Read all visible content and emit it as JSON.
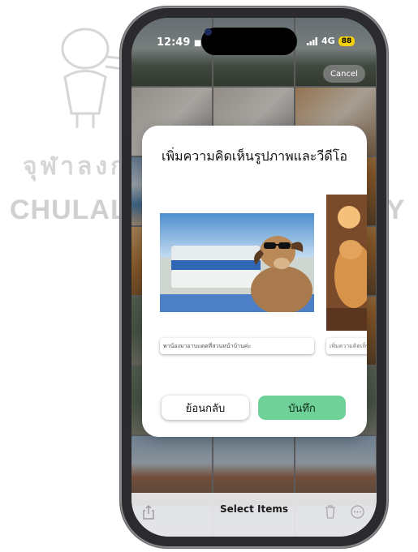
{
  "watermark": {
    "thai_text": "จุฬาลงกรณ์มหาวิทยาลัย",
    "english_text": "CHULALONGKORN UNIVERSITY",
    "left_visible": "CHULAL",
    "right_visible": "TY"
  },
  "status_bar": {
    "time": "12:49",
    "network": "4G",
    "battery": "88"
  },
  "top_bar": {
    "cancel_label": "Cancel"
  },
  "modal": {
    "title": "เพิ่มความคิดเห็นรูปภาพและวีดีโอ",
    "items": [
      {
        "caption": "พาน้องมาอาบแดดที่สวนหน้าบ้านค่ะ"
      },
      {
        "caption": "เพิ่มความคิดเห็น"
      }
    ],
    "back_label": "ย้อนกลับ",
    "save_label": "บันทึก",
    "save_color": "#6fd198"
  },
  "bottom_bar": {
    "title": "Select Items"
  },
  "icons": [
    "person-icon",
    "signal-icon",
    "share-icon",
    "trash-icon",
    "more-icon"
  ]
}
